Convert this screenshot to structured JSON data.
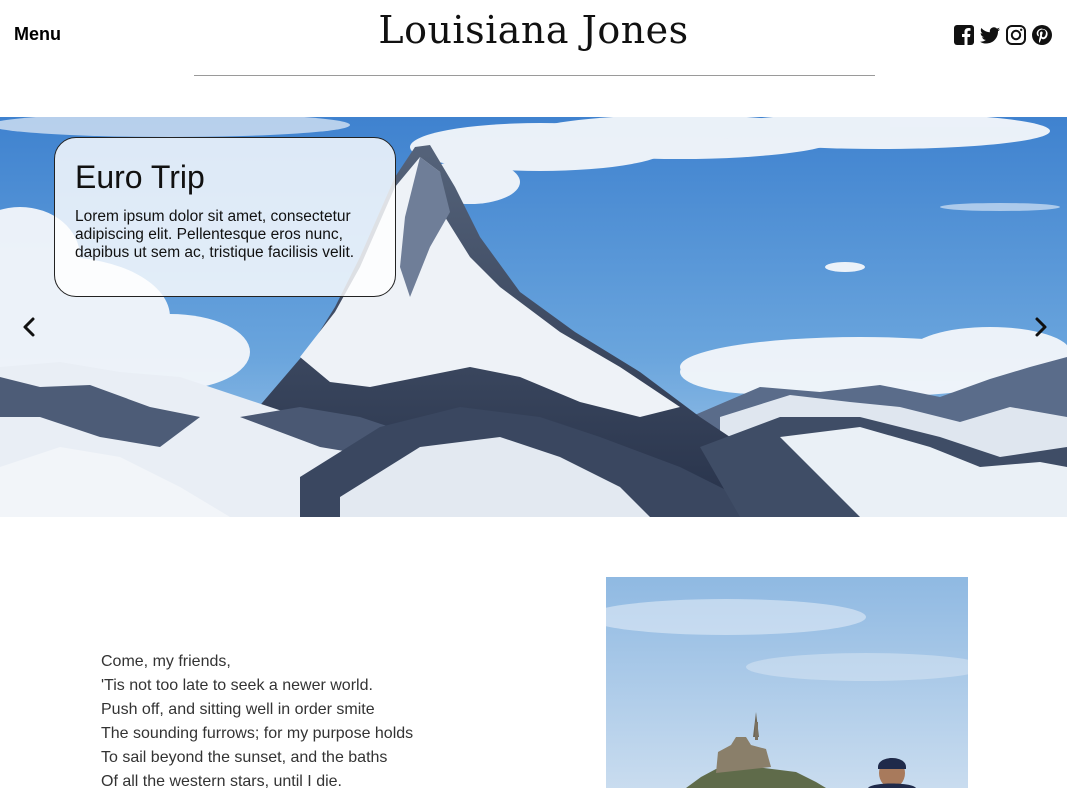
{
  "header": {
    "menu_label": "Menu",
    "site_title": "Louisiana Jones",
    "social_icons": [
      "facebook-icon",
      "twitter-icon",
      "instagram-icon",
      "pinterest-icon"
    ]
  },
  "hero": {
    "caption_title": "Euro Trip",
    "caption_text": "Lorem ipsum dolor sit amet, consectetur adipiscing elit. Pellentesque eros nunc, dapibus ut sem ac, tristique facilisis velit.",
    "prev_icon": "chevron-left-icon",
    "next_icon": "chevron-right-icon"
  },
  "poem": {
    "lines": [
      "Come, my friends,",
      "'Tis not too late to seek a newer world.",
      "Push off, and sitting well in order smite",
      "The sounding furrows; for my purpose holds",
      "To sail beyond the sunset, and the baths",
      "Of all the western stars, until I die."
    ]
  },
  "colors": {
    "sky": "#5d9ad8",
    "snow": "#eef2f7",
    "rock": "#3c4a62",
    "divider": "#9a9a9a"
  }
}
